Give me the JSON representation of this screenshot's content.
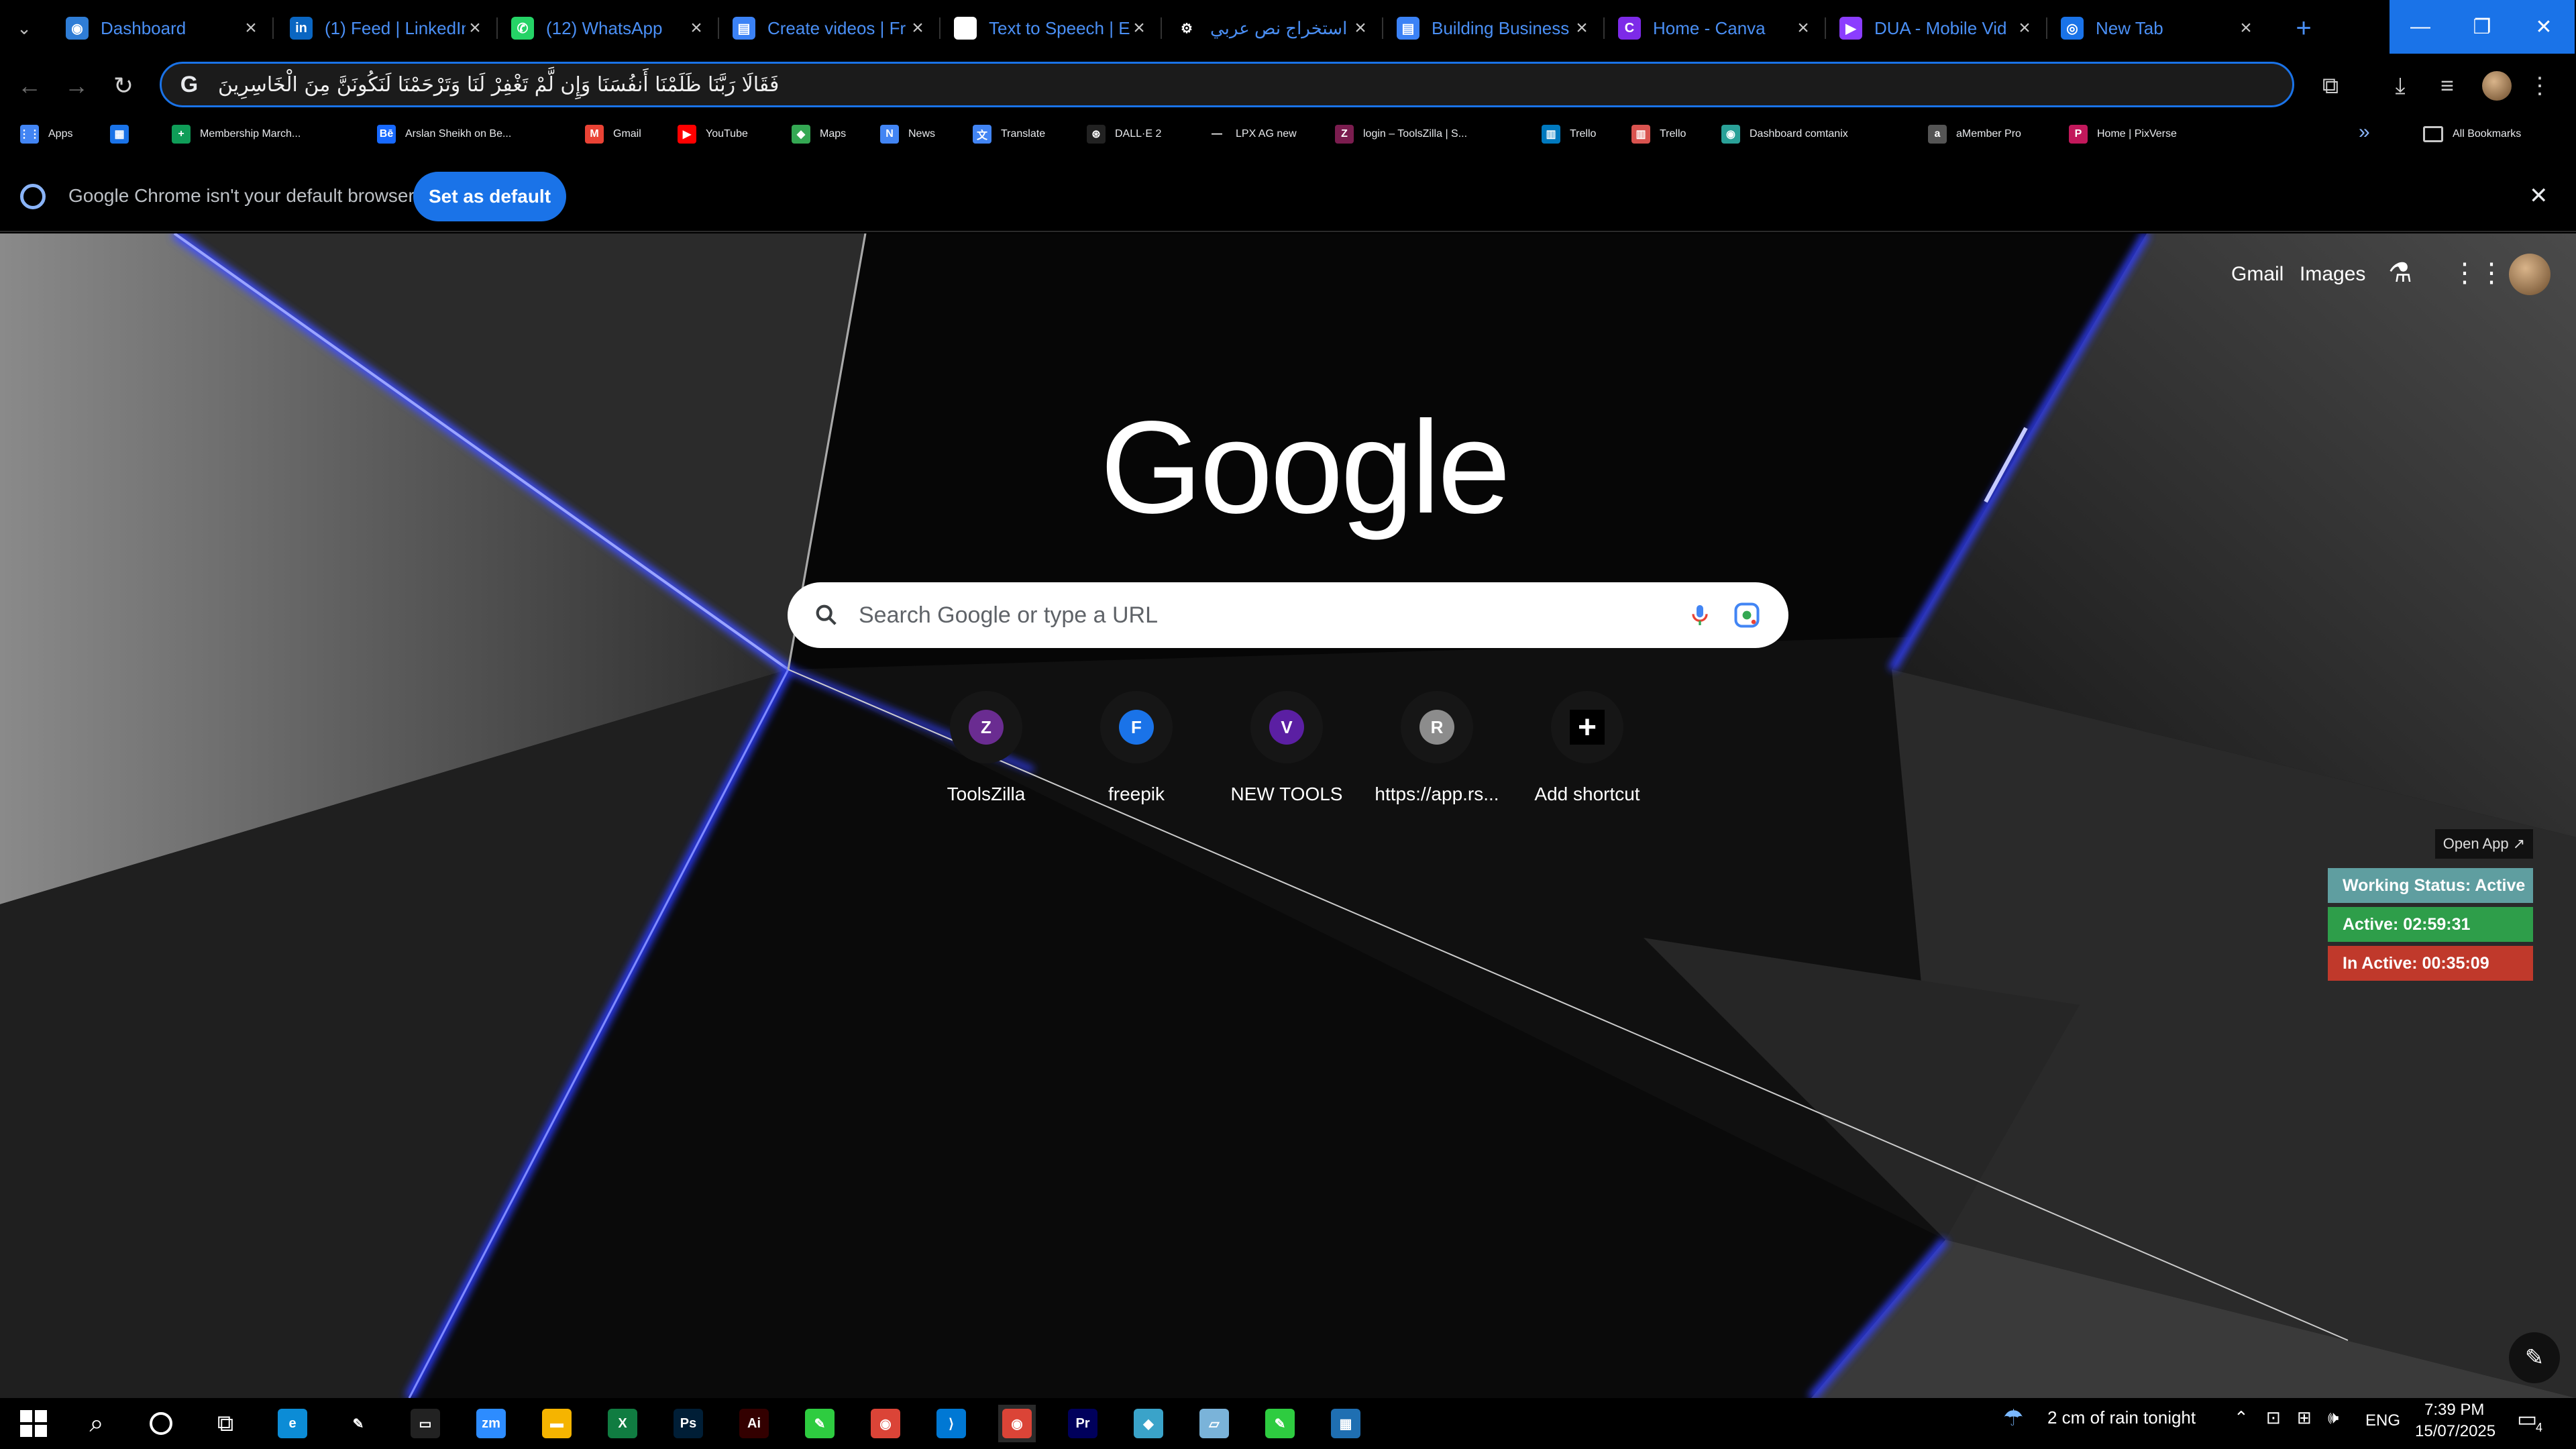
{
  "tabs": [
    {
      "title": "Dashboard",
      "icon": "dashboard-tab-icon",
      "color": "#2f7dd6",
      "glyph": "◉"
    },
    {
      "title": "(1) Feed | LinkedIn",
      "icon": "linkedin-icon",
      "color": "#0a66c2",
      "glyph": "in"
    },
    {
      "title": "(12) WhatsApp",
      "icon": "whatsapp-icon",
      "color": "#25d366",
      "glyph": "✆"
    },
    {
      "title": "Create videos | Fr",
      "icon": "document-tab-icon",
      "color": "#3b82f6",
      "glyph": "▤"
    },
    {
      "title": "Text to Speech | E",
      "icon": "pause-tab-icon",
      "color": "#ffffff",
      "glyph": "❚❚"
    },
    {
      "title": "استخراج نص عربي",
      "icon": "openai-icon",
      "color": "#000000",
      "glyph": "⚙"
    },
    {
      "title": "Building Business",
      "icon": "document-tab-icon",
      "color": "#3b82f6",
      "glyph": "▤"
    },
    {
      "title": "Home - Canva",
      "icon": "canva-icon",
      "color": "#7d2ae8",
      "glyph": "C"
    },
    {
      "title": "DUA - Mobile Vid",
      "icon": "video-tab-icon",
      "color": "#8b3dff",
      "glyph": "▶"
    },
    {
      "title": "New Tab",
      "icon": "chrome-newtab-icon",
      "color": "#1a73e8",
      "glyph": "◎"
    }
  ],
  "omnibox": {
    "text": "فَقَالَا رَبَّنَا ظَلَمْنَا أَنفُسَنَا وَإِن لَّمْ تَغْفِرْ لَنَا وَتَرْحَمْنَا لَنَكُونَنَّ مِنَ الْخَاسِرِينَ"
  },
  "bookmarks": [
    {
      "label": "Apps",
      "color": "#4285f4",
      "glyph": "⋮⋮"
    },
    {
      "label": "",
      "color": "#1a73e8",
      "glyph": "▦"
    },
    {
      "label": "Membership March...",
      "color": "#0f9d58",
      "glyph": "+"
    },
    {
      "label": "Arslan Sheikh on Be...",
      "color": "#1769ff",
      "glyph": "Bē"
    },
    {
      "label": "Gmail",
      "color": "#ea4335",
      "glyph": "M"
    },
    {
      "label": "YouTube",
      "color": "#ff0000",
      "glyph": "▶"
    },
    {
      "label": "Maps",
      "color": "#34a853",
      "glyph": "◆"
    },
    {
      "label": "News",
      "color": "#4285f4",
      "glyph": "N"
    },
    {
      "label": "Translate",
      "color": "#4285f4",
      "glyph": "文"
    },
    {
      "label": "DALL·E 2",
      "color": "#222222",
      "glyph": "⊛"
    },
    {
      "label": "LPX AG new",
      "color": "#000000",
      "glyph": "—"
    },
    {
      "label": "login – ToolsZilla | S...",
      "color": "#7b1d4f",
      "glyph": "Z"
    },
    {
      "label": "Trello",
      "color": "#0079bf",
      "glyph": "▥"
    },
    {
      "label": "Trello",
      "color": "#d9534f",
      "glyph": "▥"
    },
    {
      "label": "Dashboard comtanix",
      "color": "#2aa198",
      "glyph": "◉"
    },
    {
      "label": "aMember Pro",
      "color": "#555555",
      "glyph": "a"
    },
    {
      "label": "Home | PixVerse",
      "color": "#c2185b",
      "glyph": "P"
    }
  ],
  "bookmarks_more": "»",
  "all_bookmarks": "All Bookmarks",
  "infobar": {
    "message": "Google Chrome isn't your default browser",
    "button": "Set as default"
  },
  "ntp": {
    "gmail": "Gmail",
    "images": "Images",
    "logo": "Google",
    "search_placeholder": "Search Google or type a URL",
    "shortcuts": [
      {
        "label": "ToolsZilla",
        "glyph": "Z",
        "color": "#6a2c91"
      },
      {
        "label": "freepik",
        "glyph": "F",
        "color": "#1a73e8"
      },
      {
        "label": "NEW TOOLS",
        "glyph": "V",
        "color": "#5b1fa3"
      },
      {
        "label": "https://app.rs...",
        "glyph": "R",
        "color": "#8c8c8c"
      },
      {
        "label": "Add shortcut",
        "glyph": "+",
        "color": "#000000"
      }
    ]
  },
  "widget": {
    "open_app": "Open App ↗",
    "status": "Working Status: Active",
    "active": "Active: 02:59:31",
    "inactive": "In Active: 00:35:09"
  },
  "taskbar": {
    "weather": "2 cm of rain tonight",
    "lang": "ENG",
    "time": "7:39 PM",
    "date": "15/07/2025",
    "notifications": "4",
    "apps": [
      {
        "name": "edge-icon",
        "color": "#0c8cd6",
        "glyph": "e"
      },
      {
        "name": "pen-icon",
        "color": "#000000",
        "glyph": "✎"
      },
      {
        "name": "terminal-icon",
        "color": "#222222",
        "glyph": "▭"
      },
      {
        "name": "zoom-icon",
        "color": "#2d8cff",
        "glyph": "zm"
      },
      {
        "name": "file-explorer-icon",
        "color": "#f5b400",
        "glyph": "▬"
      },
      {
        "name": "excel-icon",
        "color": "#107c41",
        "glyph": "X"
      },
      {
        "name": "photoshop-icon",
        "color": "#001e36",
        "glyph": "Ps"
      },
      {
        "name": "illustrator-icon",
        "color": "#330000",
        "glyph": "Ai"
      },
      {
        "name": "green-app-icon",
        "color": "#2ecc40",
        "glyph": "✎"
      },
      {
        "name": "chrome-icon",
        "color": "#db4437",
        "glyph": "◉"
      },
      {
        "name": "vscode-icon",
        "color": "#0078d4",
        "glyph": "⟩"
      },
      {
        "name": "chrome-active-icon",
        "color": "#db4437",
        "glyph": "◉"
      },
      {
        "name": "premiere-icon",
        "color": "#00005b",
        "glyph": "Pr"
      },
      {
        "name": "diamond-app-icon",
        "color": "#3aa3c9",
        "glyph": "◆"
      },
      {
        "name": "notepad-icon",
        "color": "#7ab3d9",
        "glyph": "▱"
      },
      {
        "name": "green-app-2-icon",
        "color": "#2ecc40",
        "glyph": "✎"
      },
      {
        "name": "calculator-icon",
        "color": "#1f6fb2",
        "glyph": "▦"
      }
    ]
  }
}
